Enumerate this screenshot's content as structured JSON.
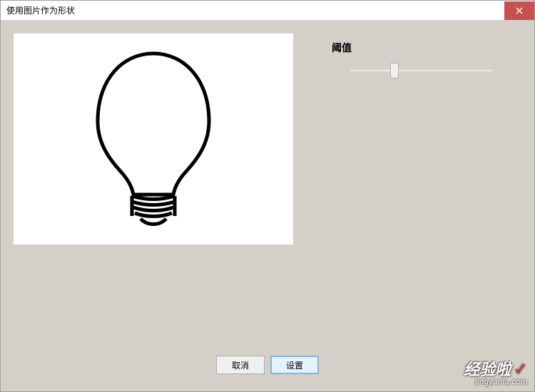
{
  "window": {
    "title": "使用图片作为形状"
  },
  "controls": {
    "threshold_label": "阈值",
    "slider_value": 28
  },
  "buttons": {
    "cancel": "取消",
    "apply": "设置"
  },
  "watermark": {
    "main": "经验啦",
    "check": "✓",
    "sub": "jingyanla.com"
  },
  "icon": {
    "preview": "lightbulb-outline"
  }
}
